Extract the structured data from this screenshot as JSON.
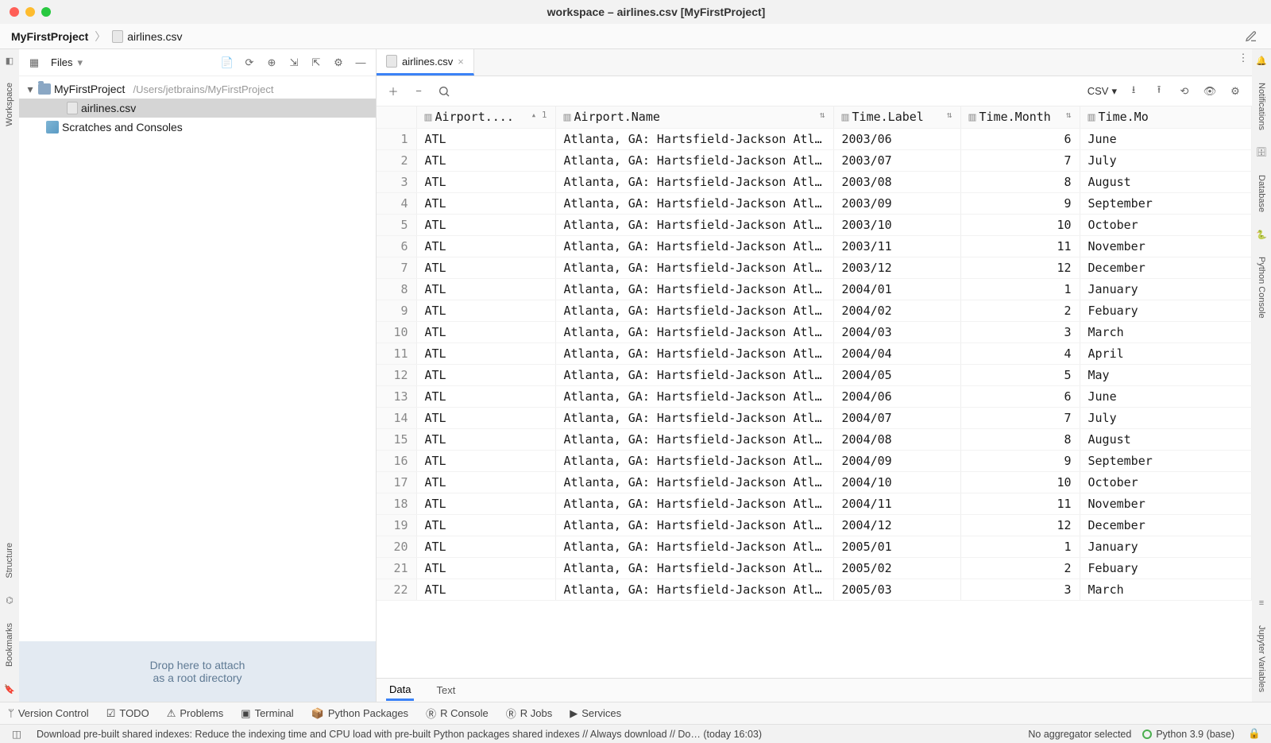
{
  "window": {
    "title": "workspace – airlines.csv [MyFirstProject]"
  },
  "breadcrumb": {
    "project": "MyFirstProject",
    "file": "airlines.csv"
  },
  "left_tool_strip": {
    "workspace": "Workspace",
    "structure": "Structure",
    "bookmarks": "Bookmarks"
  },
  "right_tool_strip": {
    "notifications": "Notifications",
    "database": "Database",
    "python_console": "Python Console",
    "jupyter_vars": "Jupyter Variables"
  },
  "project_panel": {
    "selector": "Files",
    "root": "MyFirstProject",
    "root_path": "/Users/jetbrains/MyFirstProject",
    "file1": "airlines.csv",
    "scratches": "Scratches and Consoles",
    "drop_line1": "Drop here to attach",
    "drop_line2": "as a root directory"
  },
  "tabs": {
    "tab1": "airlines.csv"
  },
  "csv_toolbar": {
    "format_label": "CSV"
  },
  "columns": {
    "c1": "Airport....",
    "c1_sort": "1",
    "c2": "Airport.Name",
    "c3": "Time.Label",
    "c4": "Time.Month",
    "c5": "Time.Mo"
  },
  "rows": [
    {
      "n": "1",
      "code": "ATL",
      "name": "Atlanta, GA: Hartsfield-Jackson Atl…",
      "label": "2003/06",
      "month": "6",
      "mname": "June"
    },
    {
      "n": "2",
      "code": "ATL",
      "name": "Atlanta, GA: Hartsfield-Jackson Atl…",
      "label": "2003/07",
      "month": "7",
      "mname": "July"
    },
    {
      "n": "3",
      "code": "ATL",
      "name": "Atlanta, GA: Hartsfield-Jackson Atl…",
      "label": "2003/08",
      "month": "8",
      "mname": "August"
    },
    {
      "n": "4",
      "code": "ATL",
      "name": "Atlanta, GA: Hartsfield-Jackson Atl…",
      "label": "2003/09",
      "month": "9",
      "mname": "September"
    },
    {
      "n": "5",
      "code": "ATL",
      "name": "Atlanta, GA: Hartsfield-Jackson Atl…",
      "label": "2003/10",
      "month": "10",
      "mname": "October"
    },
    {
      "n": "6",
      "code": "ATL",
      "name": "Atlanta, GA: Hartsfield-Jackson Atl…",
      "label": "2003/11",
      "month": "11",
      "mname": "November"
    },
    {
      "n": "7",
      "code": "ATL",
      "name": "Atlanta, GA: Hartsfield-Jackson Atl…",
      "label": "2003/12",
      "month": "12",
      "mname": "December"
    },
    {
      "n": "8",
      "code": "ATL",
      "name": "Atlanta, GA: Hartsfield-Jackson Atl…",
      "label": "2004/01",
      "month": "1",
      "mname": "January"
    },
    {
      "n": "9",
      "code": "ATL",
      "name": "Atlanta, GA: Hartsfield-Jackson Atl…",
      "label": "2004/02",
      "month": "2",
      "mname": "Febuary"
    },
    {
      "n": "10",
      "code": "ATL",
      "name": "Atlanta, GA: Hartsfield-Jackson Atl…",
      "label": "2004/03",
      "month": "3",
      "mname": "March"
    },
    {
      "n": "11",
      "code": "ATL",
      "name": "Atlanta, GA: Hartsfield-Jackson Atl…",
      "label": "2004/04",
      "month": "4",
      "mname": "April"
    },
    {
      "n": "12",
      "code": "ATL",
      "name": "Atlanta, GA: Hartsfield-Jackson Atl…",
      "label": "2004/05",
      "month": "5",
      "mname": "May"
    },
    {
      "n": "13",
      "code": "ATL",
      "name": "Atlanta, GA: Hartsfield-Jackson Atl…",
      "label": "2004/06",
      "month": "6",
      "mname": "June"
    },
    {
      "n": "14",
      "code": "ATL",
      "name": "Atlanta, GA: Hartsfield-Jackson Atl…",
      "label": "2004/07",
      "month": "7",
      "mname": "July"
    },
    {
      "n": "15",
      "code": "ATL",
      "name": "Atlanta, GA: Hartsfield-Jackson Atl…",
      "label": "2004/08",
      "month": "8",
      "mname": "August"
    },
    {
      "n": "16",
      "code": "ATL",
      "name": "Atlanta, GA: Hartsfield-Jackson Atl…",
      "label": "2004/09",
      "month": "9",
      "mname": "September"
    },
    {
      "n": "17",
      "code": "ATL",
      "name": "Atlanta, GA: Hartsfield-Jackson Atl…",
      "label": "2004/10",
      "month": "10",
      "mname": "October"
    },
    {
      "n": "18",
      "code": "ATL",
      "name": "Atlanta, GA: Hartsfield-Jackson Atl…",
      "label": "2004/11",
      "month": "11",
      "mname": "November"
    },
    {
      "n": "19",
      "code": "ATL",
      "name": "Atlanta, GA: Hartsfield-Jackson Atl…",
      "label": "2004/12",
      "month": "12",
      "mname": "December"
    },
    {
      "n": "20",
      "code": "ATL",
      "name": "Atlanta, GA: Hartsfield-Jackson Atl…",
      "label": "2005/01",
      "month": "1",
      "mname": "January"
    },
    {
      "n": "21",
      "code": "ATL",
      "name": "Atlanta, GA: Hartsfield-Jackson Atl…",
      "label": "2005/02",
      "month": "2",
      "mname": "Febuary"
    },
    {
      "n": "22",
      "code": "ATL",
      "name": "Atlanta, GA: Hartsfield-Jackson Atl…",
      "label": "2005/03",
      "month": "3",
      "mname": "March"
    }
  ],
  "bottom_tabs": {
    "data": "Data",
    "text": "Text"
  },
  "tool_windows": {
    "vcs": "Version Control",
    "todo": "TODO",
    "problems": "Problems",
    "terminal": "Terminal",
    "py_pkg": "Python Packages",
    "r_console": "R Console",
    "r_jobs": "R Jobs",
    "services": "Services"
  },
  "statusbar": {
    "message": "Download pre-built shared indexes: Reduce the indexing time and CPU load with pre-built Python packages shared indexes // Always download // Do…  (today 16:03)",
    "aggregator": "No aggregator selected",
    "interpreter": "Python 3.9 (base)"
  }
}
